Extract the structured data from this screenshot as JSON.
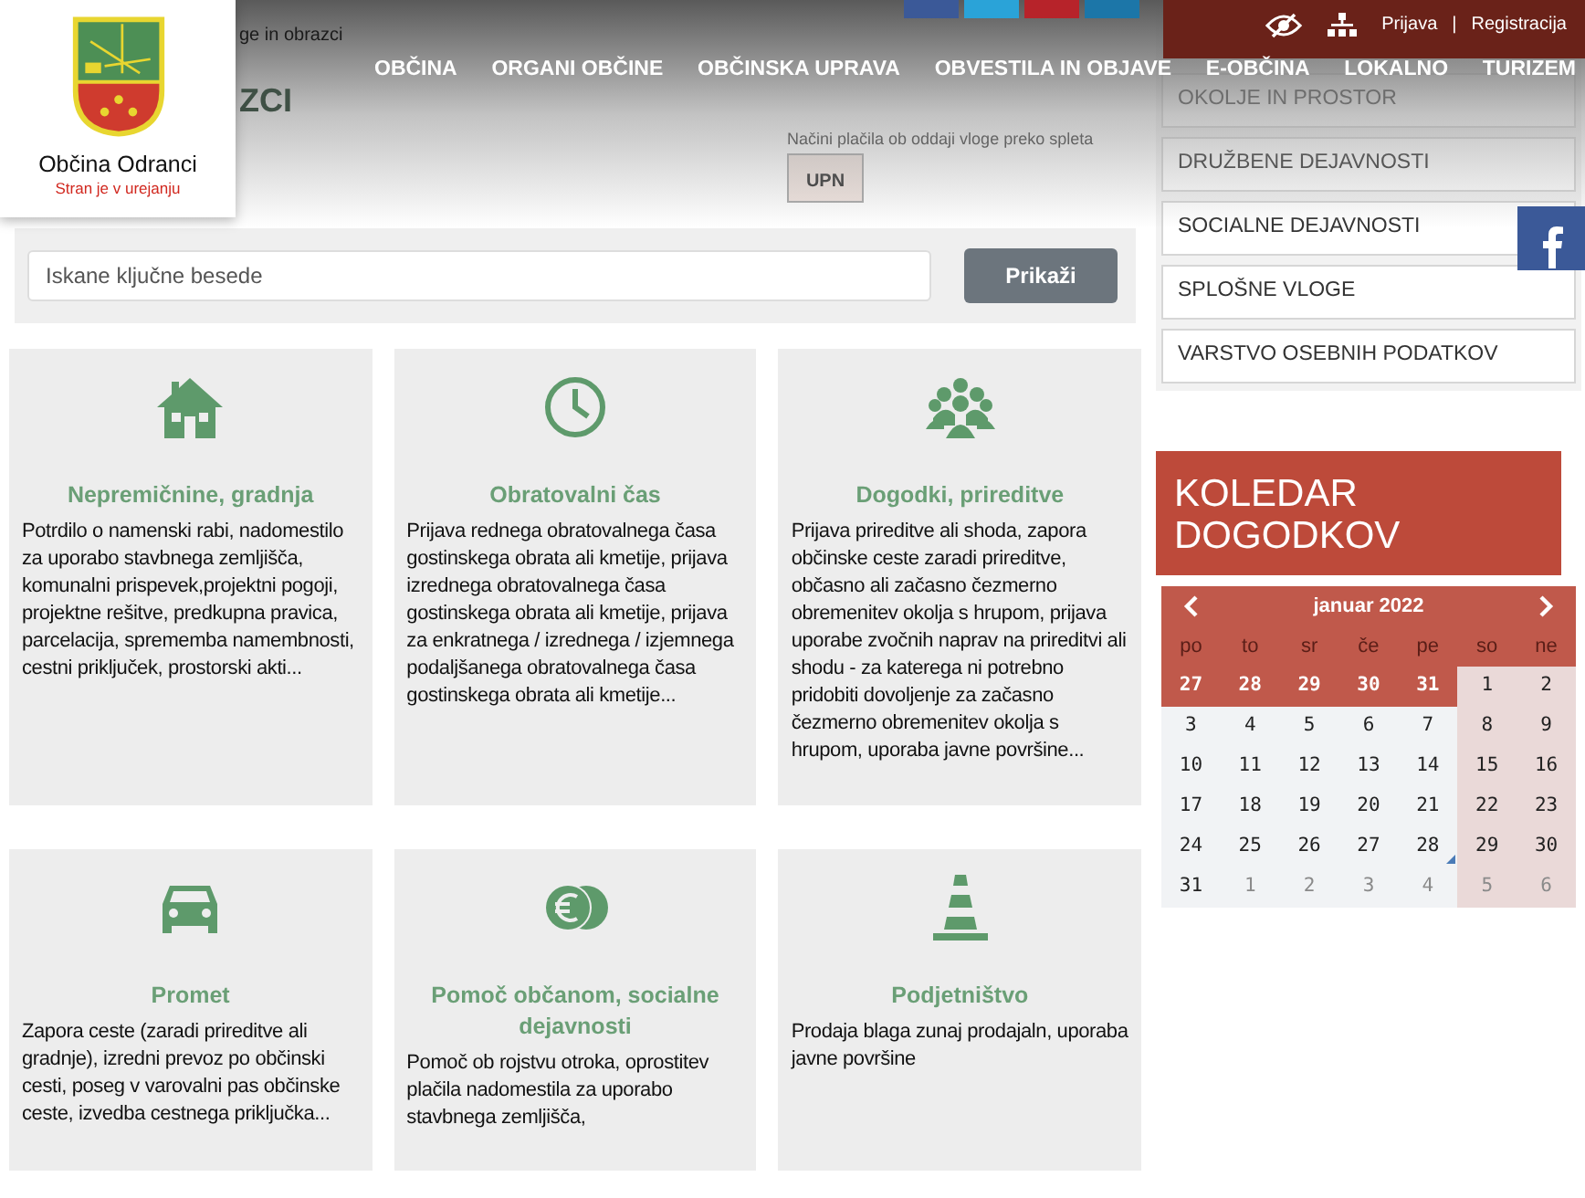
{
  "logo": {
    "title": "Občina Odranci",
    "subtitle": "Stran je v urejanju"
  },
  "breadcrumb": "ge in obrazci",
  "page_title": "ZCI",
  "top_bar": {
    "login": "Prijava",
    "separator": "|",
    "register": "Registracija"
  },
  "nav": [
    "OBČINA",
    "ORGANI OBČINE",
    "OBČINSKA UPRAVA",
    "OBVESTILA IN OBJAVE",
    "E-OBČINA",
    "LOKALNO",
    "TURIZEM"
  ],
  "payment": {
    "label": "Načini plačila ob oddaji vloge preko spleta",
    "button": "UPN"
  },
  "search": {
    "placeholder": "Iskane ključne besede",
    "button": "Prikaži"
  },
  "cards": [
    {
      "title": "Nepremičnine, gradnja",
      "text": "Potrdilo o namenski rabi, nadomestilo za uporabo stavbnega zemljišča, komunalni prispevek,projektni pogoji, projektne rešitve, predkupna pravica, parcelacija, sprememba namembnosti, cestni priključek, prostorski akti..."
    },
    {
      "title": "Obratovalni čas",
      "text": "Prijava rednega obratovalnega časa gostinskega obrata ali kmetije, prijava izrednega obratovalnega časa gostinskega obrata ali kmetije, prijava za enkratnega / izrednega / izjemnega podaljšanega obratovalnega časa gostinskega obrata ali kmetije..."
    },
    {
      "title": "Dogodki, prireditve",
      "text": "Prijava prireditve ali shoda, zapora občinske ceste zaradi prireditve, občasno ali začasno čezmerno obremenitev okolja s hrupom, prijava uporabe zvočnih naprav na prireditvi ali shodu - za katerega ni potrebno pridobiti dovoljenje za začasno čezmerno obremenitev okolja s hrupom, uporaba javne površine..."
    },
    {
      "title": "Promet",
      "text": "Zapora ceste (zaradi prireditve ali gradnje), izredni prevoz po občinski cesti, poseg v varovalni pas občinske ceste, izvedba cestnega priključka..."
    },
    {
      "title": "Pomoč občanom, socialne dejavnosti",
      "text": "Pomoč ob rojstvu otroka, oprostitev plačila nadomestila za uporabo stavbnega zemljišča,"
    },
    {
      "title": "Podjetništvo",
      "text": "Prodaja blaga zunaj prodajaln, uporaba javne površine"
    }
  ],
  "sidebar": {
    "items": [
      "OKOLJE IN PROSTOR",
      "DRUŽBENE DEJAVNOSTI",
      "SOCIALNE DEJAVNOSTI",
      "SPLOŠNE VLOGE",
      "VARSTVO OSEBNIH PODATKOV"
    ]
  },
  "calendar": {
    "title": "KOLEDAR DOGODKOV",
    "month": "januar 2022",
    "weekdays": [
      "po",
      "to",
      "sr",
      "če",
      "pe",
      "so",
      "ne"
    ],
    "days": [
      {
        "d": "27",
        "kind": "prev",
        "event": false
      },
      {
        "d": "28",
        "kind": "prev",
        "event": false
      },
      {
        "d": "29",
        "kind": "prev",
        "event": false
      },
      {
        "d": "30",
        "kind": "prev",
        "event": false
      },
      {
        "d": "31",
        "kind": "prev",
        "event": false
      },
      {
        "d": "1",
        "kind": "cur",
        "event": false
      },
      {
        "d": "2",
        "kind": "cur",
        "event": false
      },
      {
        "d": "3",
        "kind": "cur",
        "event": false
      },
      {
        "d": "4",
        "kind": "cur",
        "event": false
      },
      {
        "d": "5",
        "kind": "cur",
        "event": false
      },
      {
        "d": "6",
        "kind": "cur",
        "event": false
      },
      {
        "d": "7",
        "kind": "cur",
        "event": false
      },
      {
        "d": "8",
        "kind": "cur",
        "event": false
      },
      {
        "d": "9",
        "kind": "cur",
        "event": false
      },
      {
        "d": "10",
        "kind": "cur",
        "event": false
      },
      {
        "d": "11",
        "kind": "cur",
        "event": false
      },
      {
        "d": "12",
        "kind": "cur",
        "event": false
      },
      {
        "d": "13",
        "kind": "cur",
        "event": false
      },
      {
        "d": "14",
        "kind": "cur",
        "event": false
      },
      {
        "d": "15",
        "kind": "cur",
        "event": false
      },
      {
        "d": "16",
        "kind": "cur",
        "event": false
      },
      {
        "d": "17",
        "kind": "cur",
        "event": false
      },
      {
        "d": "18",
        "kind": "cur",
        "event": false
      },
      {
        "d": "19",
        "kind": "cur",
        "event": false
      },
      {
        "d": "20",
        "kind": "cur",
        "event": false
      },
      {
        "d": "21",
        "kind": "cur",
        "event": false
      },
      {
        "d": "22",
        "kind": "cur",
        "event": false
      },
      {
        "d": "23",
        "kind": "cur",
        "event": false
      },
      {
        "d": "24",
        "kind": "cur",
        "event": false
      },
      {
        "d": "25",
        "kind": "cur",
        "event": false
      },
      {
        "d": "26",
        "kind": "cur",
        "event": false
      },
      {
        "d": "27",
        "kind": "cur",
        "event": false
      },
      {
        "d": "28",
        "kind": "cur",
        "event": true
      },
      {
        "d": "29",
        "kind": "cur",
        "event": false
      },
      {
        "d": "30",
        "kind": "cur",
        "event": false
      },
      {
        "d": "31",
        "kind": "cur",
        "event": false
      },
      {
        "d": "1",
        "kind": "next",
        "event": false
      },
      {
        "d": "2",
        "kind": "next",
        "event": false
      },
      {
        "d": "3",
        "kind": "next",
        "event": false
      },
      {
        "d": "4",
        "kind": "next",
        "event": false
      },
      {
        "d": "5",
        "kind": "next",
        "event": false
      },
      {
        "d": "6",
        "kind": "next",
        "event": false
      }
    ]
  }
}
